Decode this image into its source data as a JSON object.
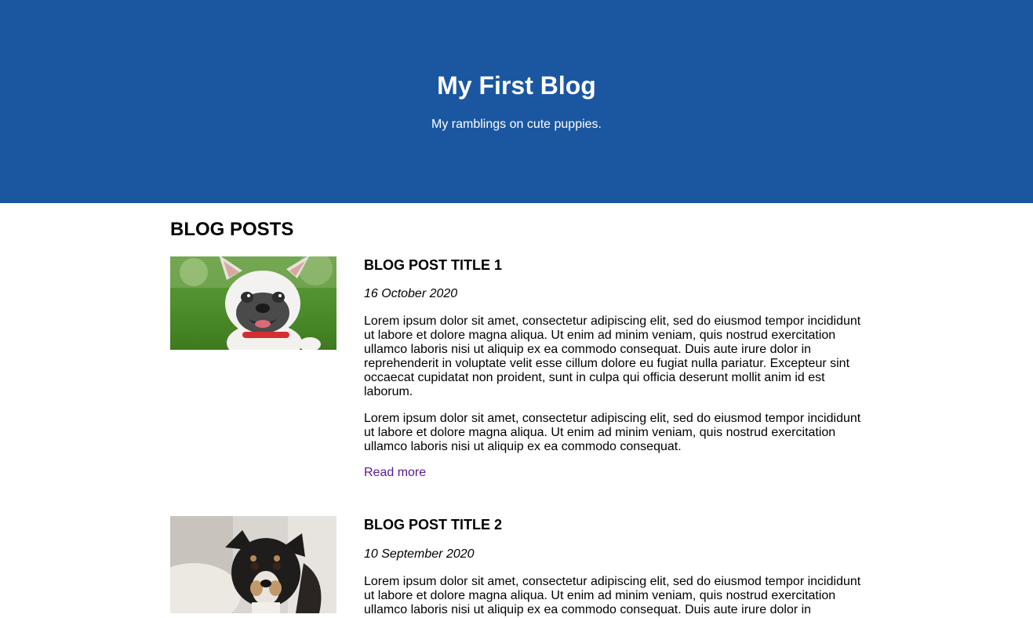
{
  "header": {
    "title": "My First Blog",
    "tagline": "My ramblings on cute puppies."
  },
  "section_title": "BLOG POSTS",
  "posts": [
    {
      "image": "french-bulldog-photo",
      "title": "BLOG POST TITLE 1",
      "date": "16 October 2020",
      "p1": "Lorem ipsum dolor sit amet, consectetur adipiscing elit, sed do eiusmod tempor incididunt ut labore et dolore magna aliqua. Ut enim ad minim veniam, quis nostrud exercitation ullamco laboris nisi ut aliquip ex ea commodo consequat. Duis aute irure dolor in reprehenderit in voluptate velit esse cillum dolore eu fugiat nulla pariatur. Excepteur sint occaecat cupidatat non proident, sunt in culpa qui officia deserunt mollit anim id est laborum.",
      "p2": "Lorem ipsum dolor sit amet, consectetur adipiscing elit, sed do eiusmod tempor incididunt ut labore et dolore magna aliqua. Ut enim ad minim veniam, quis nostrud exercitation ullamco laboris nisi ut aliquip ex ea commodo consequat.",
      "read_more": "Read more"
    },
    {
      "image": "terrier-dog-photo",
      "title": "BLOG POST TITLE 2",
      "date": "10 September 2020",
      "p1": "Lorem ipsum dolor sit amet, consectetur adipiscing elit, sed do eiusmod tempor incididunt ut labore et dolore magna aliqua. Ut enim ad minim veniam, quis nostrud exercitation ullamco laboris nisi ut aliquip ex ea commodo consequat. Duis aute irure dolor in"
    }
  ],
  "colors": {
    "header_bg": "#1b57a0",
    "link": "#5a1a8b"
  }
}
